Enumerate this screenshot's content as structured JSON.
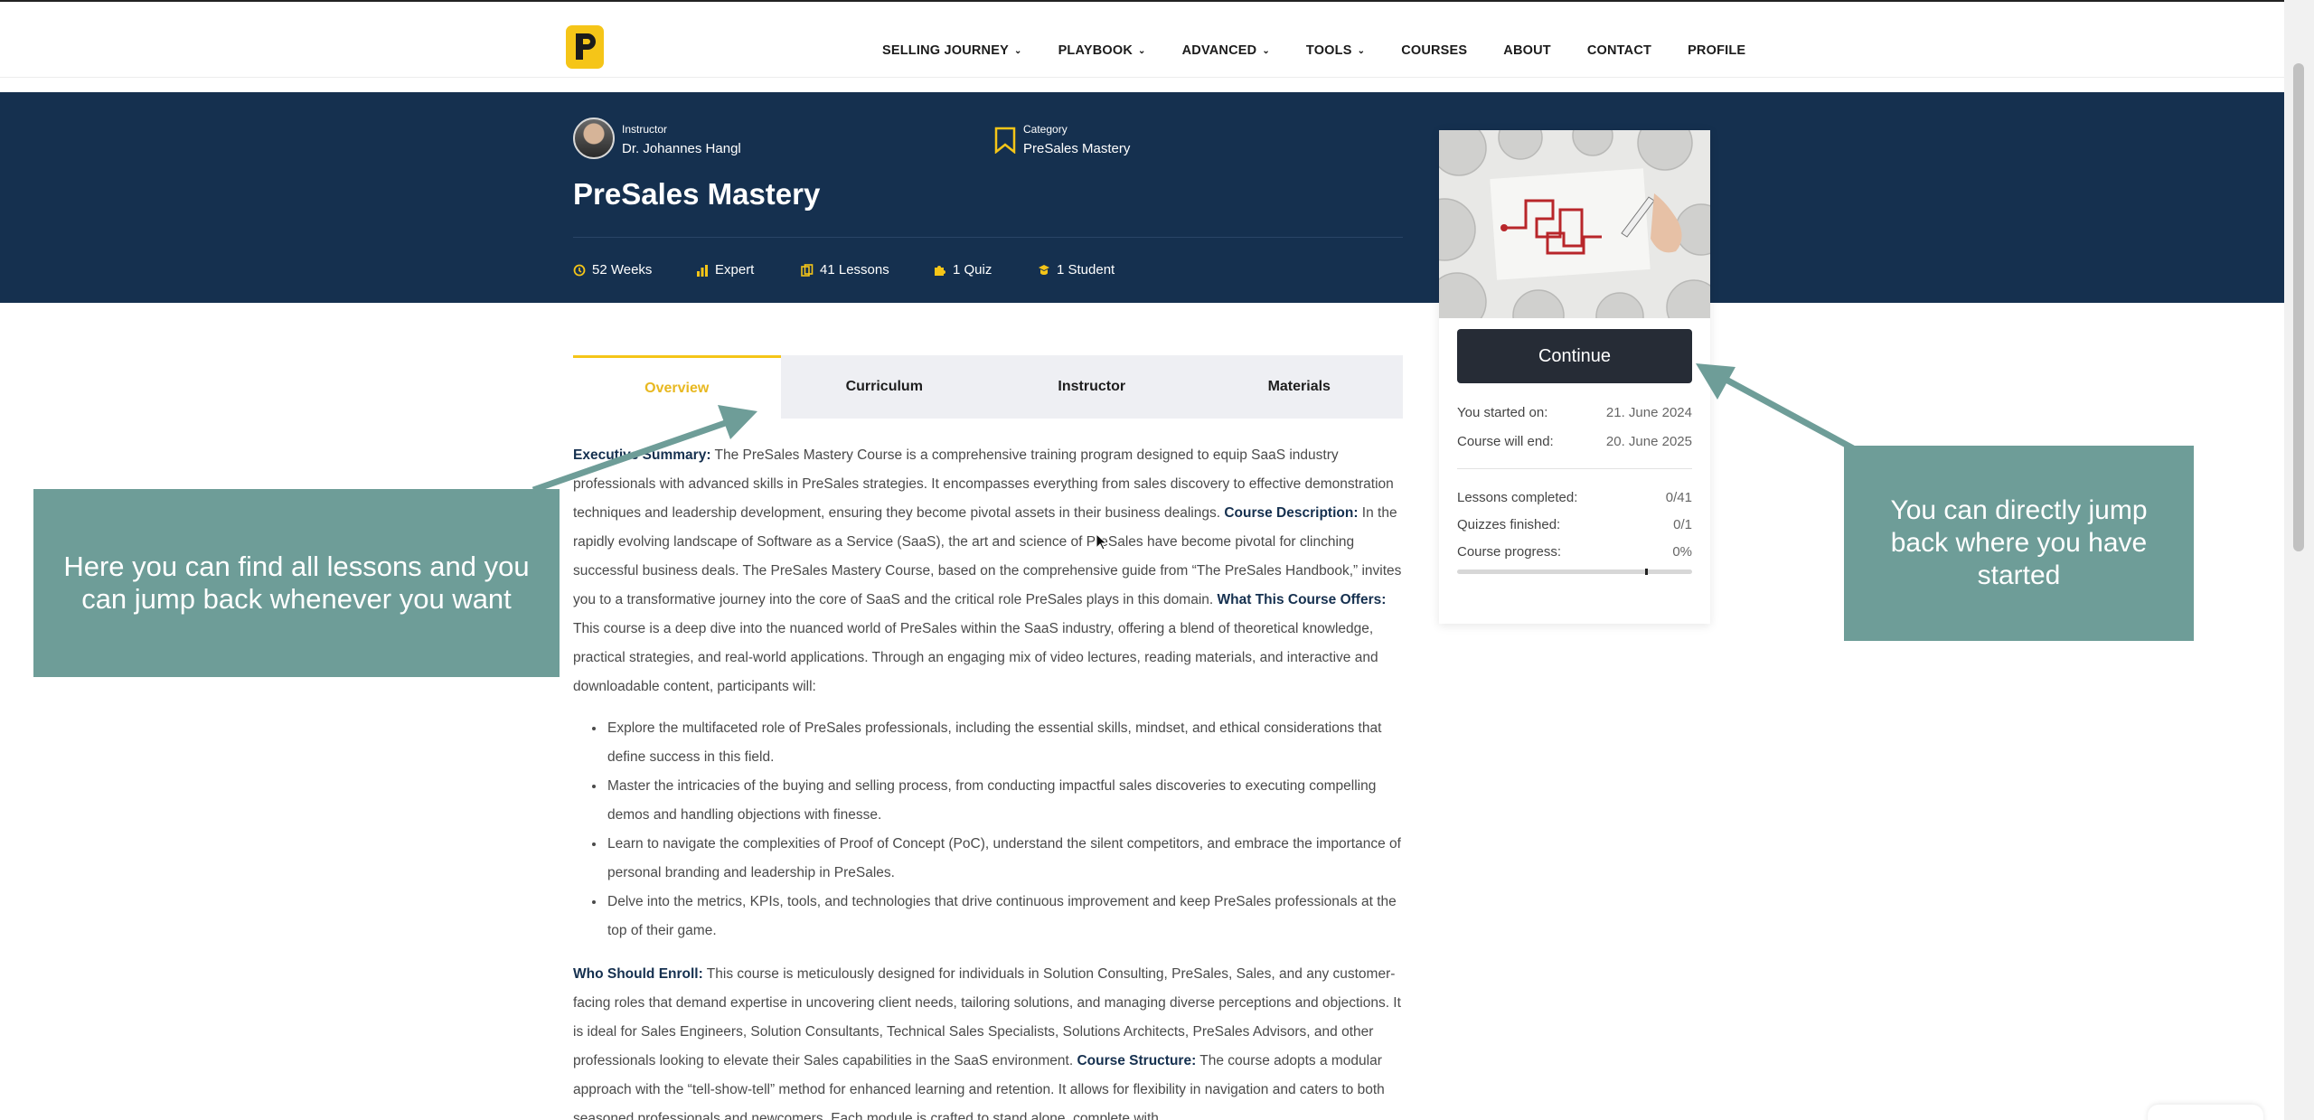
{
  "nav": {
    "items": [
      {
        "label": "SELLING JOURNEY",
        "has_dropdown": true
      },
      {
        "label": "PLAYBOOK",
        "has_dropdown": true
      },
      {
        "label": "ADVANCED",
        "has_dropdown": true
      },
      {
        "label": "TOOLS",
        "has_dropdown": true
      },
      {
        "label": "COURSES",
        "has_dropdown": false
      },
      {
        "label": "ABOUT",
        "has_dropdown": false
      },
      {
        "label": "CONTACT",
        "has_dropdown": false
      },
      {
        "label": "PROFILE",
        "has_dropdown": false
      }
    ]
  },
  "course": {
    "instructor_label": "Instructor",
    "instructor_name": "Dr. Johannes Hangl",
    "category_label": "Category",
    "category_name": "PreSales Mastery",
    "title": "PreSales Mastery",
    "meta": {
      "duration": "52 Weeks",
      "level": "Expert",
      "lessons": "41 Lessons",
      "quiz": "1 Quiz",
      "students": "1 Student"
    }
  },
  "tabs": [
    "Overview",
    "Curriculum",
    "Instructor",
    "Materials"
  ],
  "sidebar": {
    "continue_label": "Continue",
    "started_label": "You started on:",
    "started_value": "21. June 2024",
    "end_label": "Course will end:",
    "end_value": "20. June 2025",
    "lessons_label": "Lessons completed:",
    "lessons_value": "0/41",
    "quizzes_label": "Quizzes finished:",
    "quizzes_value": "0/1",
    "progress_label": "Course progress:",
    "progress_value": "0%",
    "progress_fraction": 0
  },
  "overview": {
    "p1": [
      {
        "bold": "Executive Summary:",
        "text": " The PreSales Mastery Course is a comprehensive training program designed to equip SaaS industry professionals with advanced skills in PreSales strategies. It encompasses everything from sales discovery to effective demonstration techniques and leadership development, ensuring they become pivotal assets in their business dealings. "
      },
      {
        "bold": "Course Description:",
        "text": " In the rapidly evolving landscape of Software as a Service (SaaS), the art and science of PreSales have become pivotal for clinching successful business deals. The PreSales Mastery Course, based on the comprehensive guide from “The PreSales Handbook,” invites you to a transformative journey into the core of SaaS and the critical role PreSales plays in this domain. "
      },
      {
        "bold": "What This Course Offers:",
        "text": " This course is a deep dive into the nuanced world of PreSales within the SaaS industry, offering a blend of theoretical knowledge, practical strategies, and real-world applications. Through an engaging mix of video lectures, reading materials, and interactive and downloadable content, participants will:"
      }
    ],
    "bullets": [
      "Explore the multifaceted role of PreSales professionals, including the essential skills, mindset, and ethical considerations that define success in this field.",
      "Master the intricacies of the buying and selling process, from conducting impactful sales discoveries to executing compelling demos and handling objections with finesse.",
      "Learn to navigate the complexities of Proof of Concept (PoC), understand the silent competitors, and embrace the importance of personal branding and leadership in PreSales.",
      "Delve into the metrics, KPIs, tools, and technologies that drive continuous improvement and keep PreSales professionals at the top of their game."
    ],
    "p2": [
      {
        "bold": "Who Should Enroll:",
        "text": " This course is meticulously designed for individuals in Solution Consulting, PreSales, Sales, and any customer-facing roles that demand expertise in uncovering client needs, tailoring solutions, and managing diverse perceptions and objections. It is ideal for Sales Engineers, Solution Consultants, Technical Sales Specialists, Solutions Architects, PreSales Advisors, and other professionals looking to elevate their Sales capabilities in the SaaS environment. "
      },
      {
        "bold": "Course Structure:",
        "text": " The course adopts a modular approach with the “tell-show-tell” method for enhanced learning and retention. It allows for flexibility in navigation and caters to both seasoned professionals and newcomers. Each module is crafted to stand alone, complete with"
      }
    ]
  },
  "callouts": {
    "left": "Here you can find all lessons and you can jump back whenever you want",
    "right": "You can directly jump back where you have started"
  },
  "colors": {
    "banner": "#15304f",
    "accent": "#f5c518",
    "callout": "#6e9d98",
    "button": "#262c36"
  }
}
